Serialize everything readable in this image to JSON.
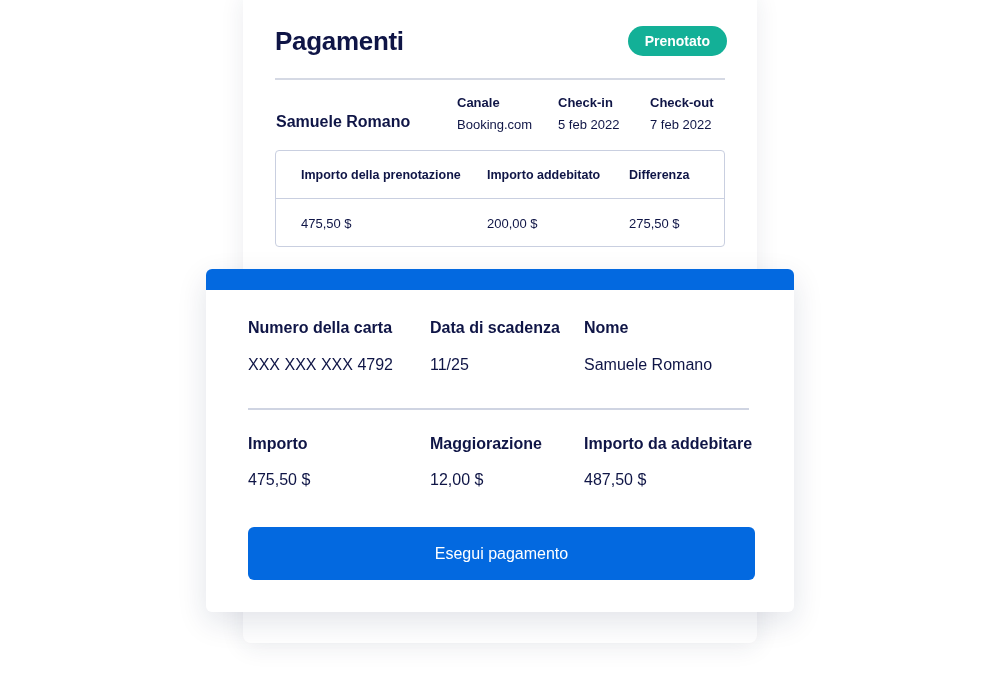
{
  "payments_card": {
    "title": "Pagamenti",
    "status_badge": "Prenotato",
    "guest_name": "Samuele Romano",
    "details": [
      {
        "label": "Canale",
        "value": "Booking.com"
      },
      {
        "label": "Check-in",
        "value": "5 feb 2022"
      },
      {
        "label": "Check-out",
        "value": "7 feb 2022"
      }
    ],
    "table": {
      "columns": [
        "Importo della prenotazione",
        "Importo addebitato",
        "Differenza"
      ],
      "rows": [
        [
          "475,50 $",
          "200,00 $",
          "275,50 $"
        ]
      ]
    }
  },
  "payment_form": {
    "card_fields": [
      {
        "label": "Numero della carta",
        "value": "XXX XXX XXX 4792"
      },
      {
        "label": "Data di scadenza",
        "value": "11/25"
      },
      {
        "label": "Nome",
        "value": "Samuele Romano"
      }
    ],
    "amount_fields": [
      {
        "label": "Importo",
        "value": "475,50 $"
      },
      {
        "label": "Maggiorazione",
        "value": "12,00 $"
      },
      {
        "label": "Importo da addebitare",
        "value": "487,50 $"
      }
    ],
    "button": "Esegui pagamento"
  }
}
